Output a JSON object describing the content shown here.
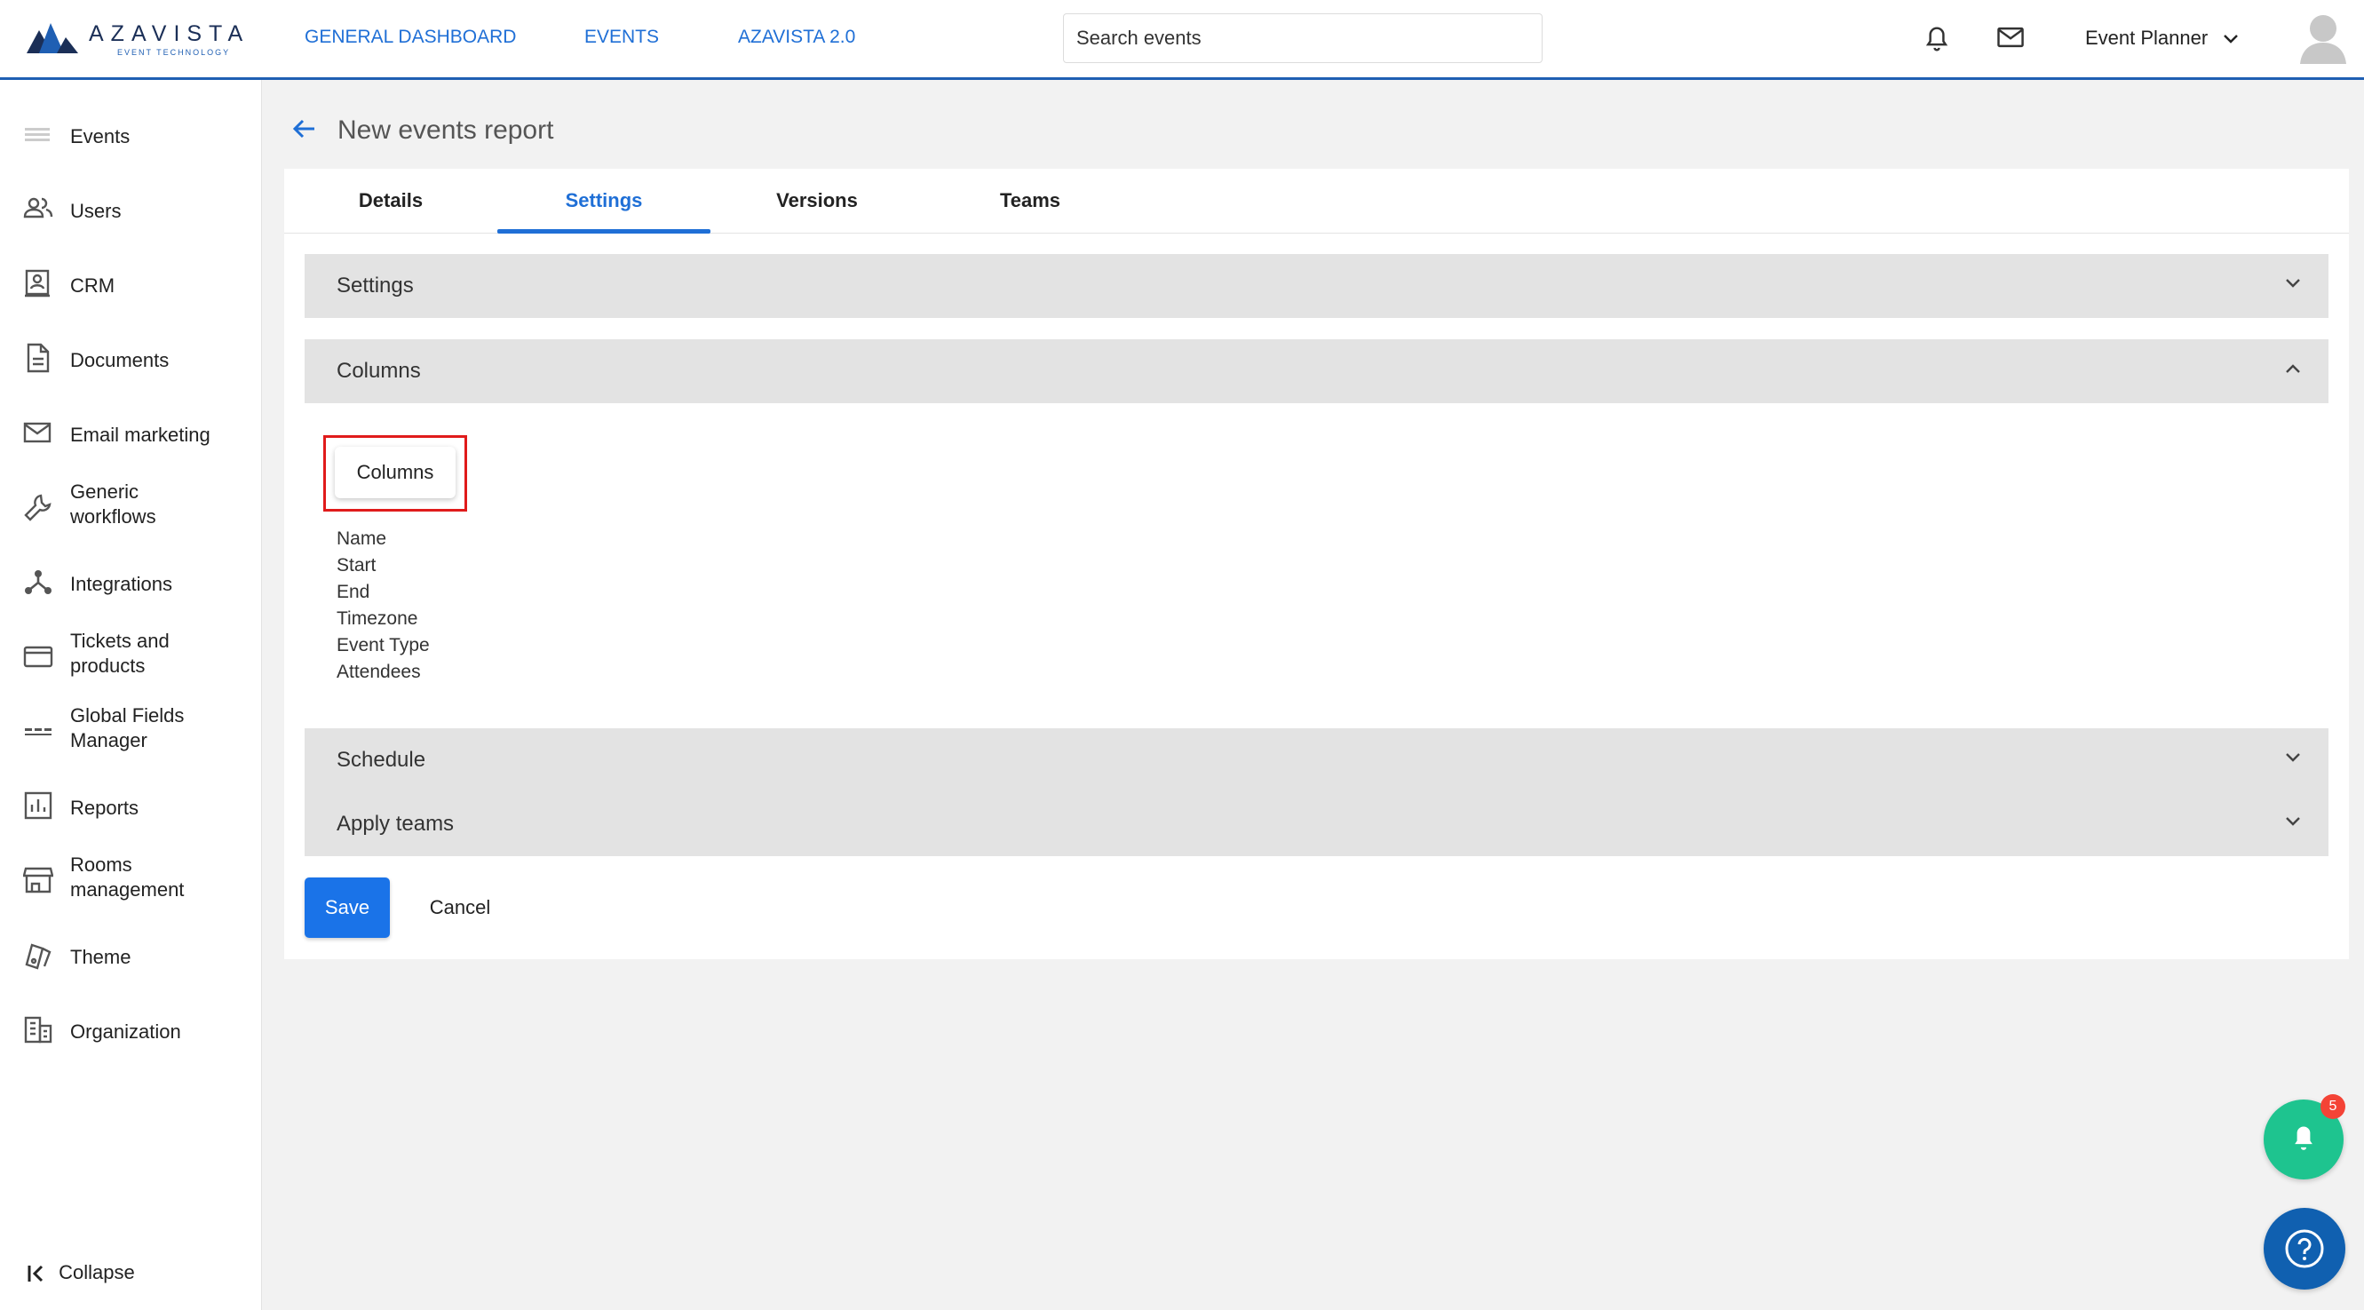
{
  "brand": {
    "name": "AZAVISTA",
    "tagline": "EVENT TECHNOLOGY"
  },
  "topnav": [
    "GENERAL DASHBOARD",
    "EVENTS",
    "AZAVISTA 2.0"
  ],
  "search": {
    "placeholder": "Search events",
    "value": ""
  },
  "header_icons": [
    "bell-icon",
    "mail-icon"
  ],
  "user": {
    "role": "Event Planner"
  },
  "sidebar": {
    "items": [
      {
        "label": "Events",
        "icon": "events-icon"
      },
      {
        "label": "Users",
        "icon": "users-icon"
      },
      {
        "label": "CRM",
        "icon": "crm-icon"
      },
      {
        "label": "Documents",
        "icon": "document-icon"
      },
      {
        "label": "Email marketing",
        "icon": "mail-icon"
      },
      {
        "label": "Generic workflows",
        "icon": "wrench-icon"
      },
      {
        "label": "Integrations",
        "icon": "integrations-icon"
      },
      {
        "label": "Tickets and products",
        "icon": "card-icon"
      },
      {
        "label": "Global Fields Manager",
        "icon": "fields-icon"
      },
      {
        "label": "Reports",
        "icon": "chart-icon"
      },
      {
        "label": "Rooms management",
        "icon": "store-icon"
      },
      {
        "label": "Theme",
        "icon": "theme-icon"
      },
      {
        "label": "Organization",
        "icon": "building-icon"
      }
    ],
    "collapse_label": "Collapse"
  },
  "page": {
    "title": "New events report"
  },
  "tabs": [
    {
      "label": "Details",
      "active": false
    },
    {
      "label": "Settings",
      "active": true
    },
    {
      "label": "Versions",
      "active": false
    },
    {
      "label": "Teams",
      "active": false
    }
  ],
  "panels": {
    "settings": {
      "title": "Settings",
      "expanded": false
    },
    "columns": {
      "title": "Columns",
      "expanded": true
    },
    "schedule": {
      "title": "Schedule",
      "expanded": false
    },
    "apply_teams": {
      "title": "Apply teams",
      "expanded": false
    }
  },
  "columns_button_label": "Columns",
  "columns_list": [
    "Name",
    "Start",
    "End",
    "Timezone",
    "Event Type",
    "Attendees"
  ],
  "actions": {
    "save": "Save",
    "cancel": "Cancel"
  },
  "notifications": {
    "badge": "5"
  },
  "colors": {
    "accent": "#1f6fd6",
    "save": "#1a73e8",
    "notify_fab": "#1ec48f",
    "help_fab": "#1060b0",
    "highlight": "#e01b1b"
  }
}
